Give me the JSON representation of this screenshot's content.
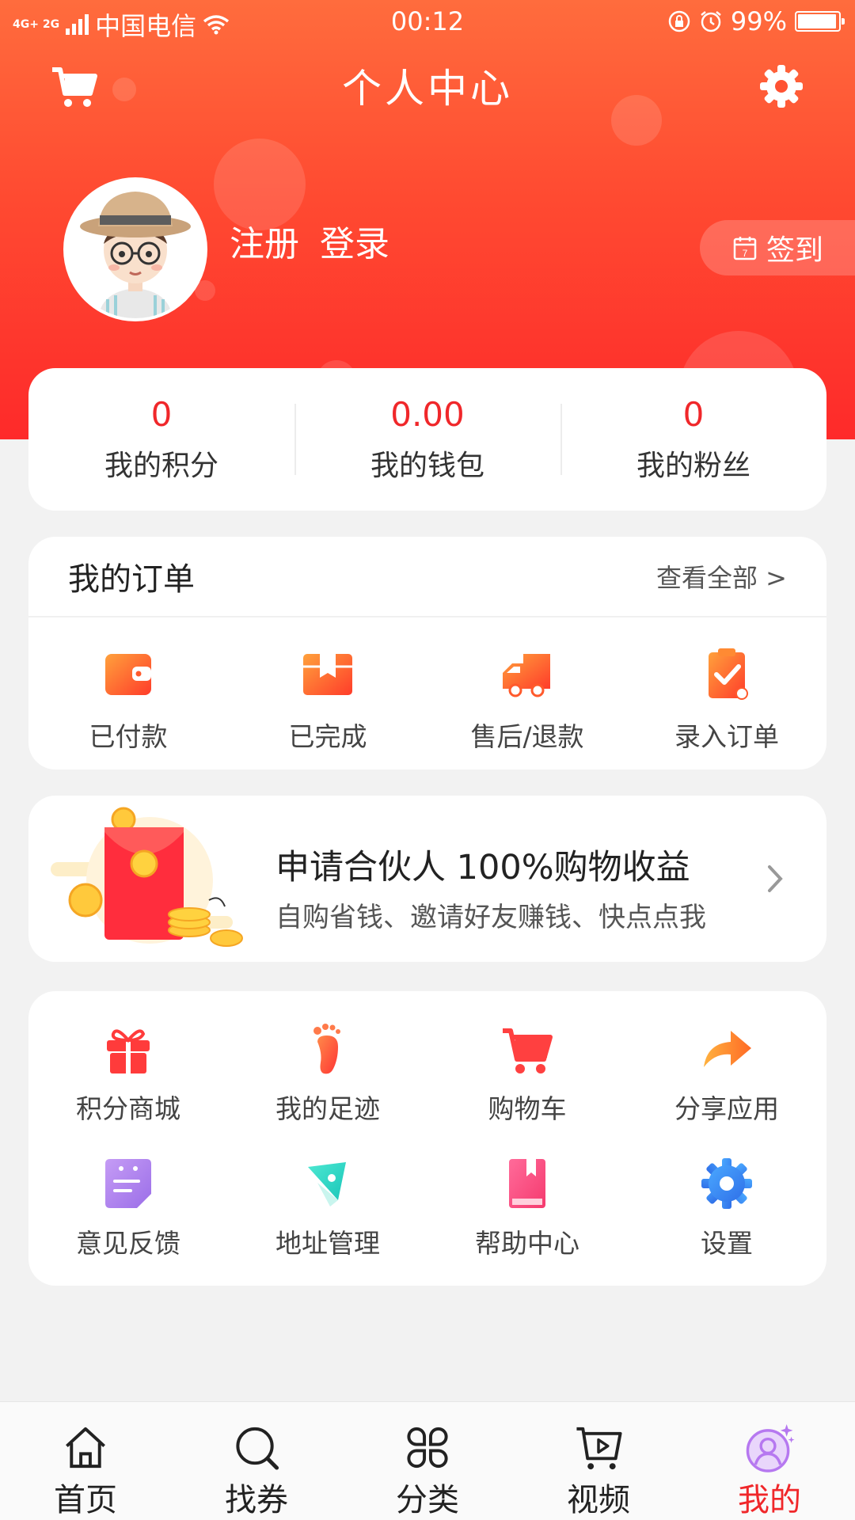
{
  "status_bar": {
    "network": "4G+ 2G",
    "carrier": "中国电信",
    "time": "00:12",
    "battery": "99%"
  },
  "header": {
    "title": "个人中心",
    "register": "注册",
    "login": "登录",
    "checkin": "签到",
    "calendar_day": "7"
  },
  "stats": [
    {
      "value": "0",
      "label": "我的积分"
    },
    {
      "value": "0.00",
      "label": "我的钱包"
    },
    {
      "value": "0",
      "label": "我的粉丝"
    }
  ],
  "orders": {
    "title": "我的订单",
    "view_all": "查看全部 >",
    "items": [
      {
        "label": "已付款",
        "icon": "wallet-icon"
      },
      {
        "label": "已完成",
        "icon": "package-icon"
      },
      {
        "label": "售后/退款",
        "icon": "truck-icon"
      },
      {
        "label": "录入订单",
        "icon": "clipboard-check-icon"
      }
    ]
  },
  "partner": {
    "title": "申请合伙人 100%购物收益",
    "subtitle": "自购省钱、邀请好友赚钱、快点点我"
  },
  "tools": [
    {
      "label": "积分商城",
      "icon": "gift-icon"
    },
    {
      "label": "我的足迹",
      "icon": "footprint-icon"
    },
    {
      "label": "购物车",
      "icon": "cart-icon"
    },
    {
      "label": "分享应用",
      "icon": "share-arrow-icon"
    },
    {
      "label": "意见反馈",
      "icon": "feedback-icon"
    },
    {
      "label": "地址管理",
      "icon": "location-icon"
    },
    {
      "label": "帮助中心",
      "icon": "book-icon"
    },
    {
      "label": "设置",
      "icon": "gear-icon"
    }
  ],
  "tabs": [
    {
      "label": "首页",
      "icon": "home-icon"
    },
    {
      "label": "找券",
      "icon": "search-icon"
    },
    {
      "label": "分类",
      "icon": "category-icon"
    },
    {
      "label": "视频",
      "icon": "video-cart-icon"
    },
    {
      "label": "我的",
      "icon": "profile-icon",
      "active": true
    }
  ],
  "colors": {
    "brand_red": "#f0272a",
    "header_top": "#ff6c3d",
    "header_bottom": "#fe2a2a",
    "active_tab_icon": "#b678f0"
  }
}
